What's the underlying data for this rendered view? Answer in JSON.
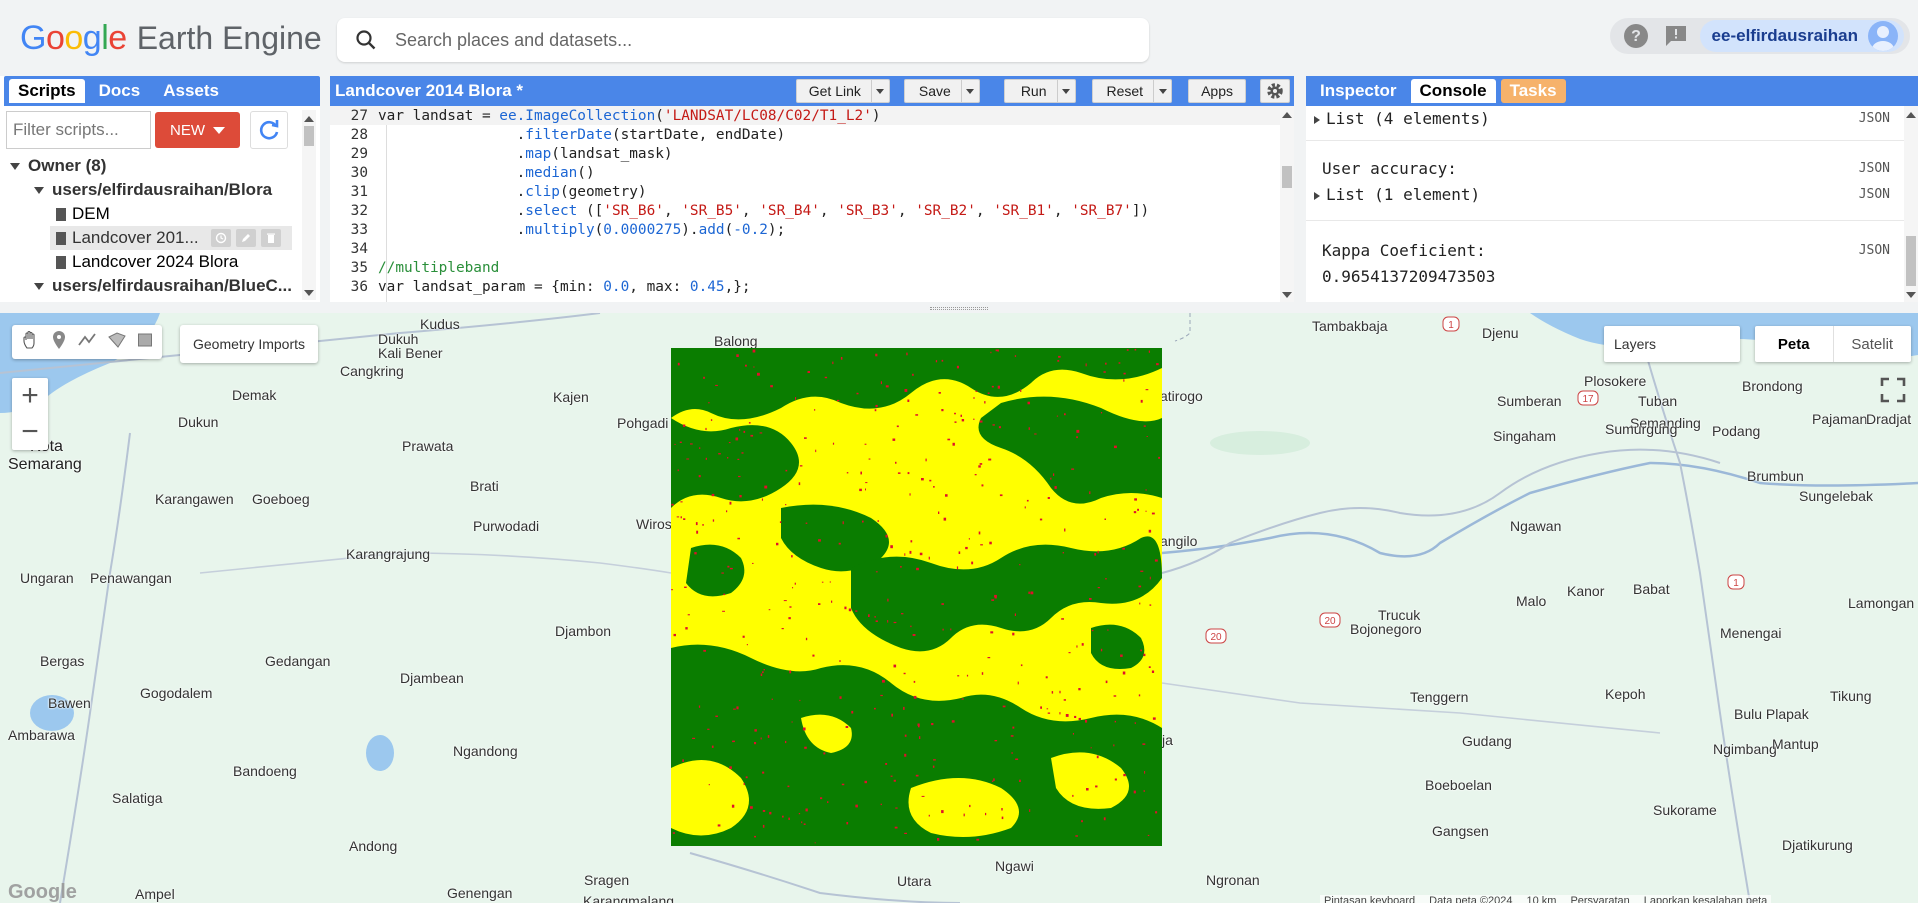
{
  "header": {
    "logo_google": "Google",
    "logo_product": "Earth Engine",
    "search_placeholder": "Search places and datasets...",
    "account": "ee-elfirdausraihan"
  },
  "left_panel": {
    "tabs": [
      "Scripts",
      "Docs",
      "Assets"
    ],
    "filter_placeholder": "Filter scripts...",
    "new_button": "NEW",
    "tree": [
      {
        "label": "Owner (8)",
        "level": 0,
        "type": "folder"
      },
      {
        "label": "users/elfirdausraihan/Blora",
        "level": 1,
        "type": "folder"
      },
      {
        "label": "DEM",
        "level": 2,
        "type": "file"
      },
      {
        "label": "Landcover 201...",
        "level": 2,
        "type": "file",
        "selected": true
      },
      {
        "label": "Landcover 2024 Blora",
        "level": 2,
        "type": "file"
      },
      {
        "label": "users/elfirdausraihan/BlueC...",
        "level": 1,
        "type": "folder"
      }
    ]
  },
  "editor": {
    "title": "Landcover 2014 Blora *",
    "buttons": {
      "get_link": "Get Link",
      "save": "Save",
      "run": "Run",
      "reset": "Reset",
      "apps": "Apps"
    },
    "lines": [
      {
        "n": "27",
        "text": "var landsat = ee.ImageCollection('LANDSAT/LC08/C02/T1_L2')"
      },
      {
        "n": "28",
        "text": "                .filterDate(startDate, endDate)"
      },
      {
        "n": "29",
        "text": "                .map(landsat_mask)"
      },
      {
        "n": "30",
        "text": "                .median()"
      },
      {
        "n": "31",
        "text": "                .clip(geometry)"
      },
      {
        "n": "32",
        "text": "                .select (['SR_B6', 'SR_B5', 'SR_B4', 'SR_B3', 'SR_B2', 'SR_B1', 'SR_B7'])"
      },
      {
        "n": "33",
        "text": "                .multiply(0.0000275).add(-0.2);"
      },
      {
        "n": "34",
        "text": ""
      },
      {
        "n": "35",
        "text": "//multipleband"
      },
      {
        "n": "36",
        "text": "var landsat_param = {min: 0.0, max: 0.45,};"
      }
    ]
  },
  "right_panel": {
    "tabs": [
      "Inspector",
      "Console",
      "Tasks"
    ],
    "console": {
      "list4": "List (4 elements)",
      "user_accuracy": "User accuracy:",
      "list1": "List (1 element)",
      "kappa_label": "Kappa Coeficient:",
      "kappa_value": "0.9654137209473503",
      "json": "JSON"
    }
  },
  "map": {
    "geometry_imports": "Geometry Imports",
    "layers": "Layers",
    "map_types": [
      "Peta",
      "Satelit"
    ],
    "places": [
      "Dukuh",
      "Kali Bener",
      "Kudus",
      "Cangkring",
      "Demak",
      "Dukun",
      "Kota",
      "Semarang",
      "Kajen",
      "Pohgadi",
      "Prawata",
      "Brati",
      "Karangawen",
      "Goeboeg",
      "Purwodadi",
      "Wiros",
      "Karangrajung",
      "Ungaran",
      "Penawangan",
      "Djambon",
      "Bergas",
      "Gedangan",
      "Djambean",
      "Gogodalem",
      "Bawen",
      "Ambarawa",
      "Ngandong",
      "Bandoeng",
      "Salatiga",
      "Andong",
      "Sragen",
      "Utara",
      "Ngawi",
      "Genengan",
      "Ampel",
      "Karangmalang",
      "Balong",
      "Tambakbaja",
      "Djenu",
      "Plosokere",
      "Tuban",
      "Brondong",
      "Sumberan",
      "Semanding",
      "Podang",
      "Pajaman",
      "Dradjat",
      "atirogo",
      "Singaham",
      "Sumurgung",
      "Brumbun",
      "Sungelebak",
      "angilo",
      "Ngawan",
      "Malo",
      "Trucuk",
      "Bojonegoro",
      "Kanor",
      "Babat",
      "Lamongan",
      "Menengai",
      "Tenggern",
      "Kepoh",
      "Bulu Plapak",
      "Tikung",
      "Gudang",
      "Ngimbang",
      "Mantup",
      "Boeboelan",
      "Sukorame",
      "Gangsen",
      "Djatikurung",
      "Ngronan",
      "ja"
    ],
    "road_numbers": [
      "1",
      "17",
      "20",
      "20",
      "1"
    ],
    "attribution": [
      "Pintasan keyboard",
      "Data peta ©2024",
      "10 km",
      "Persyaratan",
      "Laporkan kesalahan peta"
    ],
    "watermark": "Google"
  },
  "colors": {
    "panel_blue": "#4a86e8",
    "new_red": "#dd4b39",
    "tasks_orange": "#f6b26b",
    "class_forest": "#0a7d00",
    "class_crop": "#ffff00",
    "class_urban": "#e0102a",
    "map_land": "#e8f5ec",
    "map_water": "#9cc8ee"
  }
}
